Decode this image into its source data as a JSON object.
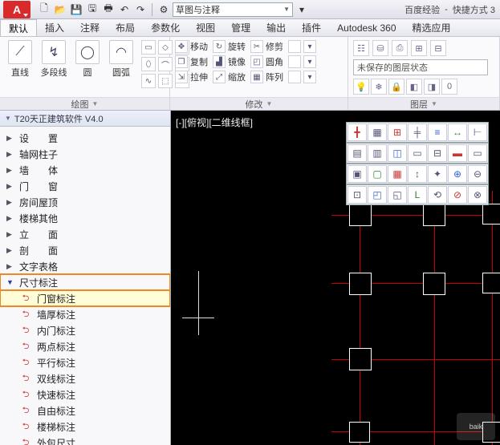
{
  "title": {
    "search": "百度经验",
    "doc": "快捷方式 3"
  },
  "qat_dropdown": "草图与注释",
  "menus": [
    "默认",
    "插入",
    "注释",
    "布局",
    "参数化",
    "视图",
    "管理",
    "输出",
    "插件",
    "Autodesk 360",
    "精选应用"
  ],
  "ribbon": {
    "draw": {
      "title": "绘图",
      "tools": [
        {
          "label": "直线",
          "glyph": "⟋"
        },
        {
          "label": "多段线",
          "glyph": "↯"
        },
        {
          "label": "圆",
          "glyph": "◯"
        },
        {
          "label": "圆弧",
          "glyph": "◠"
        }
      ]
    },
    "modify": {
      "title": "修改",
      "rows": [
        [
          {
            "g": "✥",
            "t": "移动"
          },
          {
            "g": "↻",
            "t": "旋转"
          },
          {
            "g": "✂",
            "t": "修剪"
          },
          {
            "g": "",
            "t": ""
          }
        ],
        [
          {
            "g": "❐",
            "t": "复制"
          },
          {
            "g": "▟",
            "t": "镜像"
          },
          {
            "g": "◰",
            "t": "圆角"
          },
          {
            "g": "",
            "t": ""
          }
        ],
        [
          {
            "g": "⇲",
            "t": "拉伸"
          },
          {
            "g": "⤢",
            "t": "缩放"
          },
          {
            "g": "▦",
            "t": "阵列"
          },
          {
            "g": "",
            "t": ""
          }
        ]
      ]
    },
    "layer": {
      "title": "图层",
      "state": "未保存的图层状态"
    }
  },
  "sidebar": {
    "title": "T20天正建筑软件  V4.0",
    "top_items": [
      "设　　置",
      "轴网柱子",
      "墙　　体",
      "门　　窗",
      "房间屋顶",
      "楼梯其他",
      "立　　面",
      "剖　　面",
      "文字表格",
      "尺寸标注"
    ],
    "sub_items": [
      "门窗标注",
      "墙厚标注",
      "内门标注",
      "两点标注",
      "平行标注",
      "双线标注",
      "快速标注",
      "自由标注",
      "楼梯标注",
      "外包尺寸"
    ]
  },
  "canvas": {
    "label": "[-][俯视][二维线框]"
  },
  "watermark": "baik"
}
